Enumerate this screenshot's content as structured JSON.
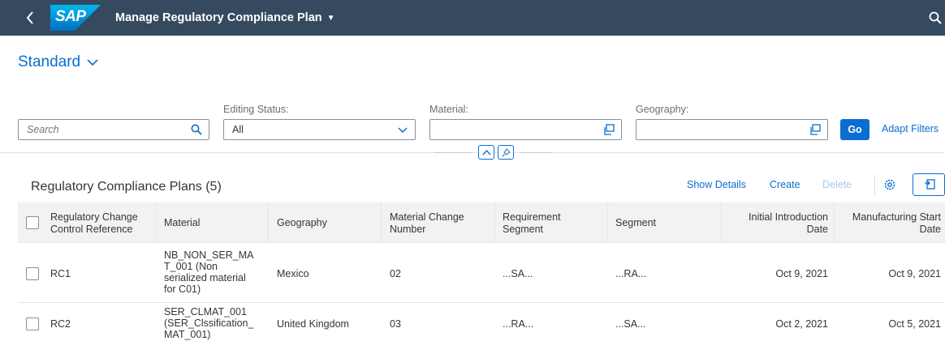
{
  "shell": {
    "logo": "SAP",
    "title": "Manage Regulatory Compliance Plan"
  },
  "variant": {
    "label": "Standard"
  },
  "filters": {
    "search_placeholder": "Search",
    "editing_status_label": "Editing Status:",
    "editing_status_value": "All",
    "material_label": "Material:",
    "material_value": "",
    "geography_label": "Geography:",
    "geography_value": "",
    "go_label": "Go",
    "adapt_label": "Adapt Filters"
  },
  "table": {
    "title": "Regulatory Compliance Plans (5)",
    "toolbar": {
      "show_details": "Show Details",
      "create": "Create",
      "delete": "Delete"
    },
    "columns": {
      "ref": [
        "Regulatory Change",
        "Control Reference"
      ],
      "material": "Material",
      "geography": "Geography",
      "mcn": [
        "Material Change",
        "Number"
      ],
      "reqseg": [
        "Requirement",
        "Segment"
      ],
      "segment": "Segment",
      "intro": [
        "Initial Introduction",
        "Date"
      ],
      "mfg": [
        "Manufacturing Start",
        "Date"
      ]
    },
    "rows": [
      {
        "ref": "RC1",
        "material": [
          "NB_NON_SER_MA",
          "T_001 (Non",
          "serialized material",
          "for C01)"
        ],
        "geography": "Mexico",
        "mcn": "02",
        "reqseg": "...SA...",
        "segment": "...RA...",
        "intro": "Oct 9, 2021",
        "mfg": "Oct 9, 2021"
      },
      {
        "ref": "RC2",
        "material": [
          "SER_CLMAT_001",
          "(SER_Clssification_",
          "MAT_001)"
        ],
        "geography": "United Kingdom",
        "mcn": "03",
        "reqseg": "...RA...",
        "segment": "...SA...",
        "intro": "Oct 2, 2021",
        "mfg": "Oct 5, 2021"
      }
    ]
  },
  "colors": {
    "shell": "#354a5f",
    "accent": "#0a6ed1"
  },
  "icons": [
    "back-icon",
    "search-icon",
    "chevron-down-icon",
    "value-help-icon",
    "collapse-icon",
    "pin-icon",
    "gear-icon",
    "export-icon"
  ]
}
